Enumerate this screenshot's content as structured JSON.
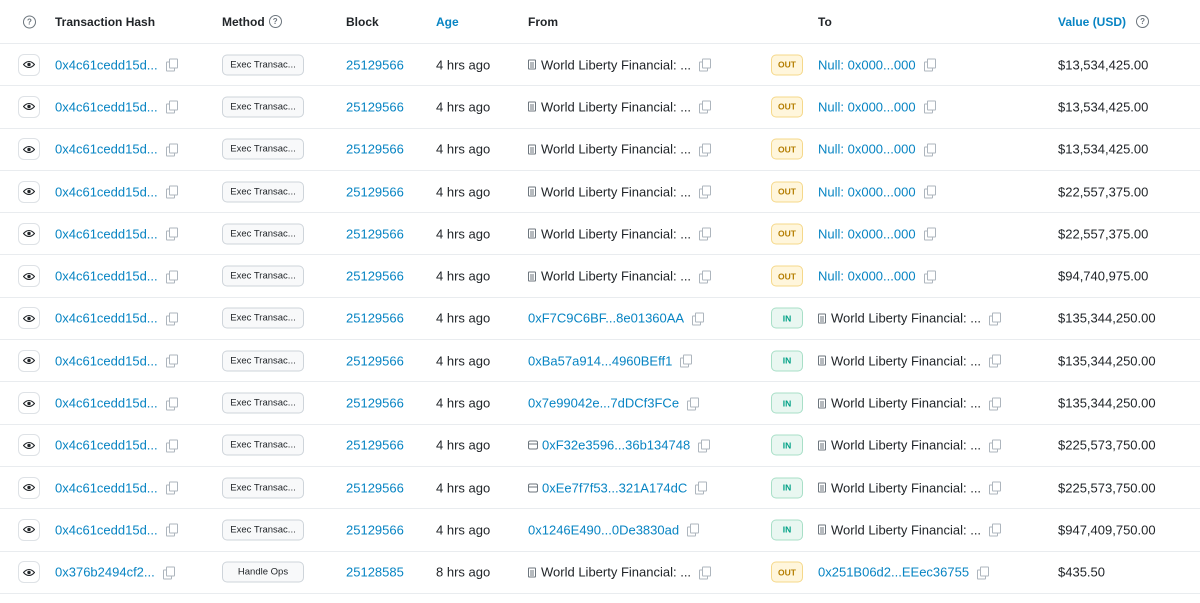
{
  "headers": {
    "hash": "Transaction Hash",
    "method": "Method",
    "block": "Block",
    "age": "Age",
    "from": "From",
    "to": "To",
    "value": "Value (USD)"
  },
  "rows": [
    {
      "hash": "0x4c61cedd15d...",
      "method": "Exec Transac...",
      "block": "25129566",
      "age": "4 hrs ago",
      "from": "World Liberty Financial: ...",
      "from_type": "doc",
      "from_link": false,
      "dir": "OUT",
      "to": "Null: 0x000...000",
      "to_type": "none",
      "to_link": true,
      "value": "$13,534,425.00"
    },
    {
      "hash": "0x4c61cedd15d...",
      "method": "Exec Transac...",
      "block": "25129566",
      "age": "4 hrs ago",
      "from": "World Liberty Financial: ...",
      "from_type": "doc",
      "from_link": false,
      "dir": "OUT",
      "to": "Null: 0x000...000",
      "to_type": "none",
      "to_link": true,
      "value": "$13,534,425.00"
    },
    {
      "hash": "0x4c61cedd15d...",
      "method": "Exec Transac...",
      "block": "25129566",
      "age": "4 hrs ago",
      "from": "World Liberty Financial: ...",
      "from_type": "doc",
      "from_link": false,
      "dir": "OUT",
      "to": "Null: 0x000...000",
      "to_type": "none",
      "to_link": true,
      "value": "$13,534,425.00"
    },
    {
      "hash": "0x4c61cedd15d...",
      "method": "Exec Transac...",
      "block": "25129566",
      "age": "4 hrs ago",
      "from": "World Liberty Financial: ...",
      "from_type": "doc",
      "from_link": false,
      "dir": "OUT",
      "to": "Null: 0x000...000",
      "to_type": "none",
      "to_link": true,
      "value": "$22,557,375.00"
    },
    {
      "hash": "0x4c61cedd15d...",
      "method": "Exec Transac...",
      "block": "25129566",
      "age": "4 hrs ago",
      "from": "World Liberty Financial: ...",
      "from_type": "doc",
      "from_link": false,
      "dir": "OUT",
      "to": "Null: 0x000...000",
      "to_type": "none",
      "to_link": true,
      "value": "$22,557,375.00"
    },
    {
      "hash": "0x4c61cedd15d...",
      "method": "Exec Transac...",
      "block": "25129566",
      "age": "4 hrs ago",
      "from": "World Liberty Financial: ...",
      "from_type": "doc",
      "from_link": false,
      "dir": "OUT",
      "to": "Null: 0x000...000",
      "to_type": "none",
      "to_link": true,
      "value": "$94,740,975.00"
    },
    {
      "hash": "0x4c61cedd15d...",
      "method": "Exec Transac...",
      "block": "25129566",
      "age": "4 hrs ago",
      "from": "0xF7C9C6BF...8e01360AA",
      "from_type": "none",
      "from_link": true,
      "dir": "IN",
      "to": "World Liberty Financial: ...",
      "to_type": "doc",
      "to_link": false,
      "value": "$135,344,250.00"
    },
    {
      "hash": "0x4c61cedd15d...",
      "method": "Exec Transac...",
      "block": "25129566",
      "age": "4 hrs ago",
      "from": "0xBa57a914...4960BEff1",
      "from_type": "none",
      "from_link": true,
      "dir": "IN",
      "to": "World Liberty Financial: ...",
      "to_type": "doc",
      "to_link": false,
      "value": "$135,344,250.00"
    },
    {
      "hash": "0x4c61cedd15d...",
      "method": "Exec Transac...",
      "block": "25129566",
      "age": "4 hrs ago",
      "from": "0x7e99042e...7dDCf3FCe",
      "from_type": "none",
      "from_link": true,
      "dir": "IN",
      "to": "World Liberty Financial: ...",
      "to_type": "doc",
      "to_link": false,
      "value": "$135,344,250.00"
    },
    {
      "hash": "0x4c61cedd15d...",
      "method": "Exec Transac...",
      "block": "25129566",
      "age": "4 hrs ago",
      "from": "0xF32e3596...36b134748",
      "from_type": "contract",
      "from_link": true,
      "dir": "IN",
      "to": "World Liberty Financial: ...",
      "to_type": "doc",
      "to_link": false,
      "value": "$225,573,750.00"
    },
    {
      "hash": "0x4c61cedd15d...",
      "method": "Exec Transac...",
      "block": "25129566",
      "age": "4 hrs ago",
      "from": "0xEe7f7f53...321A174dC",
      "from_type": "contract",
      "from_link": true,
      "dir": "IN",
      "to": "World Liberty Financial: ...",
      "to_type": "doc",
      "to_link": false,
      "value": "$225,573,750.00"
    },
    {
      "hash": "0x4c61cedd15d...",
      "method": "Exec Transac...",
      "block": "25129566",
      "age": "4 hrs ago",
      "from": "0x1246E490...0De3830ad",
      "from_type": "none",
      "from_link": true,
      "dir": "IN",
      "to": "World Liberty Financial: ...",
      "to_type": "doc",
      "to_link": false,
      "value": "$947,409,750.00"
    },
    {
      "hash": "0x376b2494cf2...",
      "method": "Handle Ops",
      "block": "25128585",
      "age": "8 hrs ago",
      "from": "World Liberty Financial: ...",
      "from_type": "doc",
      "from_link": false,
      "dir": "OUT",
      "to": "0x251B06d2...EEec36755",
      "to_type": "none",
      "to_link": true,
      "value": "$435.50"
    }
  ],
  "icons": {
    "header_info": "question-circle-icon",
    "view": "eye-icon",
    "copy": "copy-icon",
    "doc": "document-icon",
    "contract": "contract-icon"
  },
  "colors": {
    "link": "#0784c3",
    "out_bg": "#fff6dc",
    "in_bg": "#e9f7f1",
    "border": "#e9ecef"
  }
}
